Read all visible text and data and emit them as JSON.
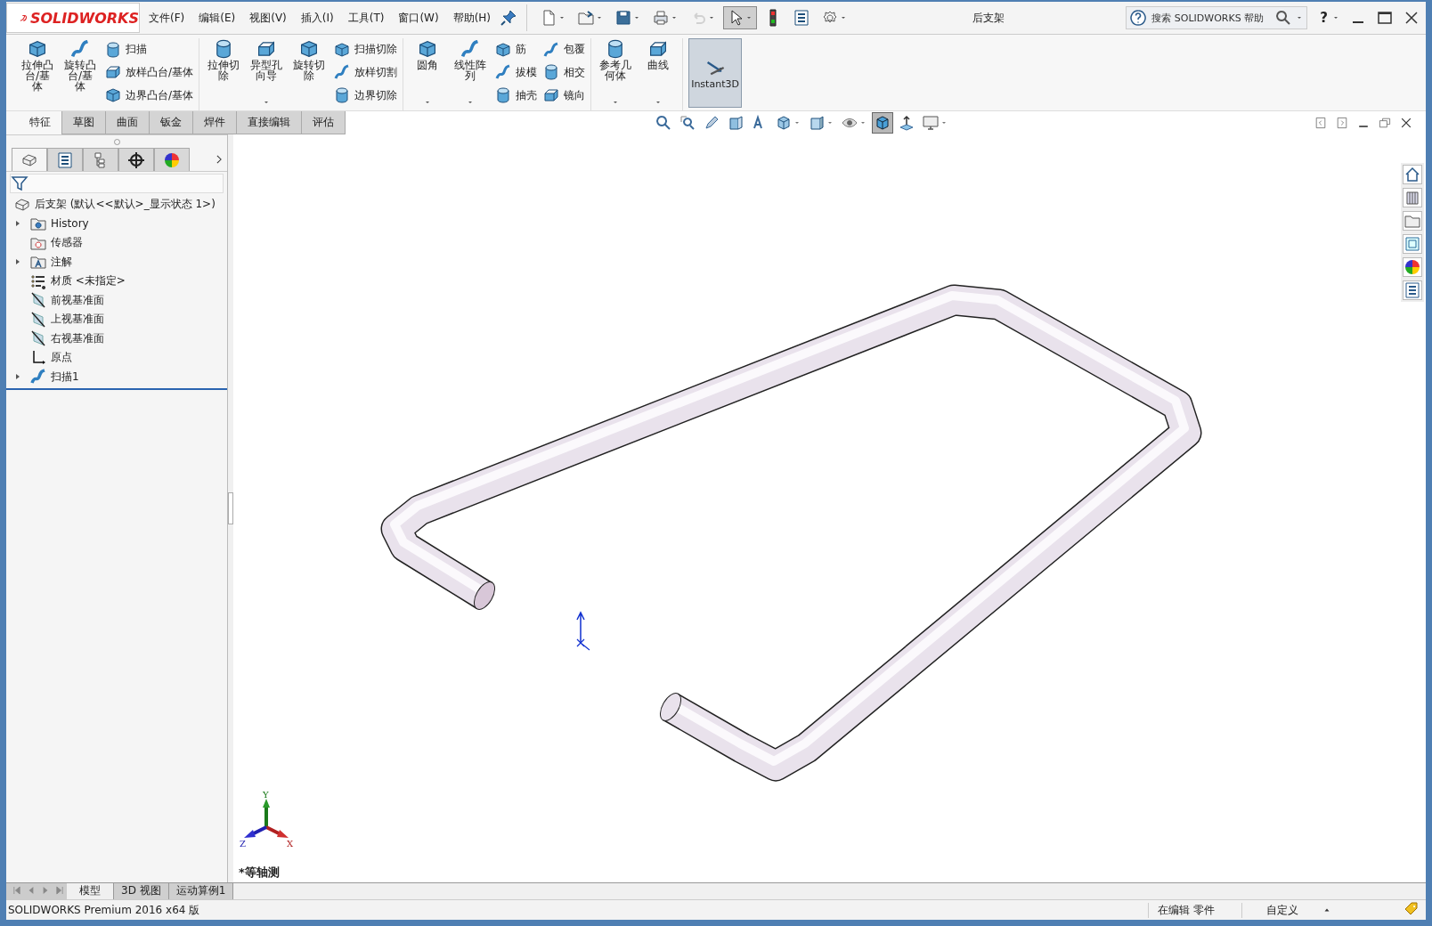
{
  "app": {
    "logo": "SOLIDWORKS",
    "menus": [
      "文件(F)",
      "编辑(E)",
      "视图(V)",
      "插入(I)",
      "工具(T)",
      "窗口(W)",
      "帮助(H)"
    ],
    "title": "后支架",
    "search": {
      "placeholder": "搜索 SOLIDWORKS 帮助"
    },
    "help": "?"
  },
  "quick_tools": [
    {
      "kind": "new",
      "menu": true,
      "disabled": false,
      "selected": false
    },
    {
      "kind": "open",
      "menu": true,
      "disabled": false,
      "selected": false
    },
    {
      "kind": "save",
      "menu": true,
      "disabled": false,
      "selected": false
    },
    {
      "kind": "print",
      "menu": true,
      "disabled": false,
      "selected": false
    },
    {
      "kind": "undo",
      "menu": true,
      "disabled": true,
      "selected": false
    },
    {
      "kind": "select",
      "menu": true,
      "disabled": false,
      "selected": true
    },
    {
      "kind": "light",
      "menu": false,
      "disabled": false,
      "selected": false
    },
    {
      "kind": "list",
      "menu": false,
      "disabled": false,
      "selected": false
    },
    {
      "kind": "gear",
      "menu": true,
      "disabled": false,
      "selected": false
    }
  ],
  "ribbon": {
    "groups": [
      {
        "items": [
          {
            "kind": "large",
            "label": "拉伸凸台/基体",
            "menu": false
          },
          {
            "kind": "large",
            "label": "旋转凸台/基体",
            "menu": false
          },
          {
            "kind": "stack",
            "items": [
              "扫描",
              "放样凸台/基体",
              "边界凸台/基体"
            ]
          }
        ]
      },
      {
        "items": [
          {
            "kind": "large",
            "label": "拉伸切除",
            "menu": false
          },
          {
            "kind": "large",
            "label": "异型孔向导",
            "menu": true
          },
          {
            "kind": "large",
            "label": "旋转切除",
            "menu": false
          },
          {
            "kind": "stack",
            "items": [
              "扫描切除",
              "放样切割",
              "边界切除"
            ]
          }
        ]
      },
      {
        "items": [
          {
            "kind": "large",
            "label": "圆角",
            "menu": true
          },
          {
            "kind": "large",
            "label": "线性阵列",
            "menu": true
          },
          {
            "kind": "stack",
            "items": [
              "筋",
              "拔模",
              "抽壳"
            ]
          },
          {
            "kind": "stack",
            "items": [
              "包覆",
              "相交",
              "镜向"
            ]
          }
        ]
      },
      {
        "items": [
          {
            "kind": "large",
            "label": "参考几何体",
            "menu": true
          },
          {
            "kind": "large",
            "label": "曲线",
            "menu": true
          }
        ]
      },
      {
        "items": [
          {
            "kind": "toggle",
            "label": "Instant3D",
            "selected": true
          }
        ]
      }
    ]
  },
  "command_tabs": [
    {
      "label": "特征",
      "selected": true
    },
    {
      "label": "草图",
      "selected": false
    },
    {
      "label": "曲面",
      "selected": false
    },
    {
      "label": "钣金",
      "selected": false
    },
    {
      "label": "焊件",
      "selected": false
    },
    {
      "label": "直接编辑",
      "selected": false
    },
    {
      "label": "评估",
      "selected": false
    }
  ],
  "view_tools": [
    {
      "kind": "zoom",
      "menu": false,
      "selected": false
    },
    {
      "kind": "zoom-area",
      "menu": false,
      "selected": false
    },
    {
      "kind": "previous",
      "menu": false,
      "selected": false
    },
    {
      "kind": "section",
      "menu": false,
      "selected": false
    },
    {
      "kind": "annotation",
      "menu": false,
      "selected": false
    },
    {
      "kind": "orient",
      "menu": true,
      "selected": false
    },
    {
      "kind": "display",
      "menu": true,
      "selected": false
    },
    {
      "kind": "eye",
      "menu": true,
      "selected": false
    },
    {
      "kind": "shaded",
      "menu": false,
      "selected": true
    },
    {
      "kind": "scene",
      "menu": false,
      "selected": false
    },
    {
      "kind": "monitor",
      "menu": true,
      "selected": false
    }
  ],
  "panel": {
    "tabs": [
      {
        "kind": "feature-tree",
        "selected": true
      },
      {
        "kind": "property",
        "selected": false
      },
      {
        "kind": "config",
        "selected": false
      },
      {
        "kind": "target",
        "selected": false
      },
      {
        "kind": "appearance",
        "selected": false
      }
    ],
    "tree": {
      "root": "后支架  (默认<<默认>_显示状态 1>)",
      "items": [
        {
          "kind": "folder",
          "label": "History",
          "expandable": true
        },
        {
          "kind": "sensor",
          "label": "传感器",
          "expandable": false
        },
        {
          "kind": "annotation",
          "label": "注解",
          "expandable": true
        },
        {
          "kind": "material",
          "label": "材质 <未指定>",
          "expandable": false
        },
        {
          "kind": "plane",
          "label": "前视基准面",
          "expandable": false
        },
        {
          "kind": "plane",
          "label": "上视基准面",
          "expandable": false
        },
        {
          "kind": "plane",
          "label": "右视基准面",
          "expandable": false
        },
        {
          "kind": "origin",
          "label": "原点",
          "expandable": false
        },
        {
          "kind": "sweep",
          "label": "扫描1",
          "expandable": true
        }
      ]
    }
  },
  "viewport": {
    "view_name": "*等轴测",
    "triad": {
      "x": "X",
      "y": "Y",
      "z": "Z"
    }
  },
  "bottom_tabs": [
    {
      "label": "模型",
      "selected": true
    },
    {
      "label": "3D 视图",
      "selected": false
    },
    {
      "label": "运动算例1",
      "selected": false
    }
  ],
  "status": {
    "product": "SOLIDWORKS Premium 2016 x64 版",
    "mode": "在编辑 零件",
    "units": "自定义"
  }
}
